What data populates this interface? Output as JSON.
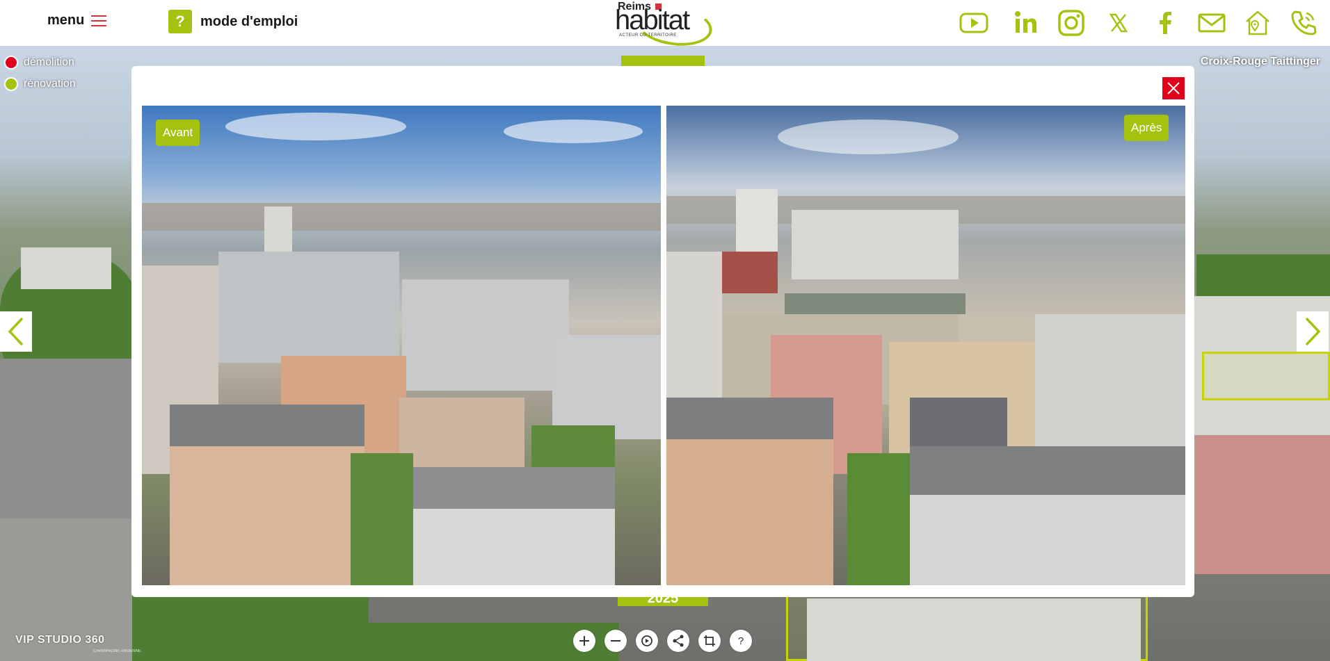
{
  "header": {
    "menu_label": "menu",
    "help_icon_glyph": "?",
    "help_label": "mode d'emploi",
    "logo": {
      "line1": "Reims",
      "line2": "habitat",
      "tagline": "ACTEUR DU TERRITOIRE"
    },
    "social_icons": [
      "youtube-icon",
      "linkedin-icon",
      "instagram-icon",
      "x-icon",
      "facebook-icon",
      "mail-icon",
      "home-location-icon",
      "phone-icon"
    ]
  },
  "legend": {
    "items": [
      {
        "label": "démolition",
        "color": "#e0001b"
      },
      {
        "label": "rénovation",
        "color": "#a6c210"
      }
    ]
  },
  "location_label": "Croix-Rouge Taittinger",
  "year_label": "2025",
  "modal": {
    "before_label": "Avant",
    "after_label": "Après"
  },
  "toolbar": {
    "buttons": [
      "zoom-in-icon",
      "zoom-out-icon",
      "autorotate-icon",
      "share-icon",
      "fullscreen-icon",
      "help-icon"
    ],
    "help_glyph": "?"
  },
  "credit": {
    "brand": "VIP STUDIO 360",
    "sub": "CHAMPAGNE ARDENNE"
  },
  "colors": {
    "accent": "#a6c210",
    "danger": "#e0001b",
    "menu_accent": "#d6323d"
  }
}
